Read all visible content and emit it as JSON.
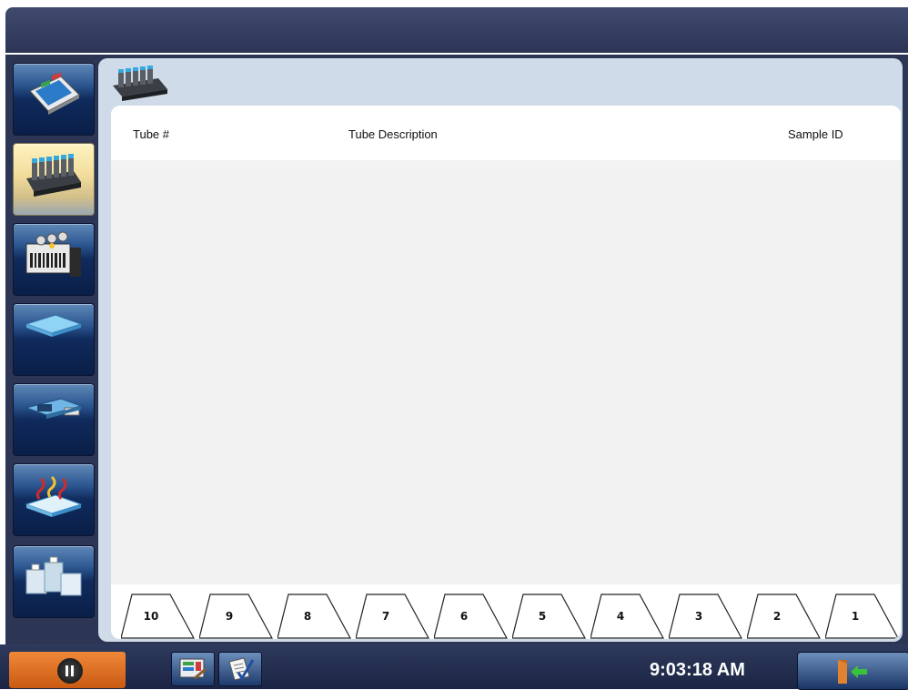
{
  "table": {
    "columns": [
      {
        "label": "Tube #"
      },
      {
        "label": "Tube Description"
      },
      {
        "label": "Sample ID"
      }
    ],
    "rows": []
  },
  "tube_tabs": [
    "10",
    "9",
    "8",
    "7",
    "6",
    "5",
    "4",
    "3",
    "2",
    "1"
  ],
  "status_bar": {
    "time": "9:03:18 AM"
  },
  "nav": {
    "items": [
      {
        "icon": "instrument-panel-icon",
        "active": false
      },
      {
        "icon": "tube-rack-icon",
        "active": true
      },
      {
        "icon": "reagent-rack-icon",
        "active": false
      },
      {
        "icon": "cartridge-tray-icon",
        "active": false
      },
      {
        "icon": "loader-module-icon",
        "active": false
      },
      {
        "icon": "heat-plate-icon",
        "active": false
      },
      {
        "icon": "reagent-bottles-icon",
        "active": false
      }
    ]
  },
  "colors": {
    "frame": "#2d3554",
    "panel": "#cfdbe8",
    "active_nav": "#f2dc9c",
    "pause_button": "#e0722a",
    "table_body": "#f2f2f2"
  }
}
